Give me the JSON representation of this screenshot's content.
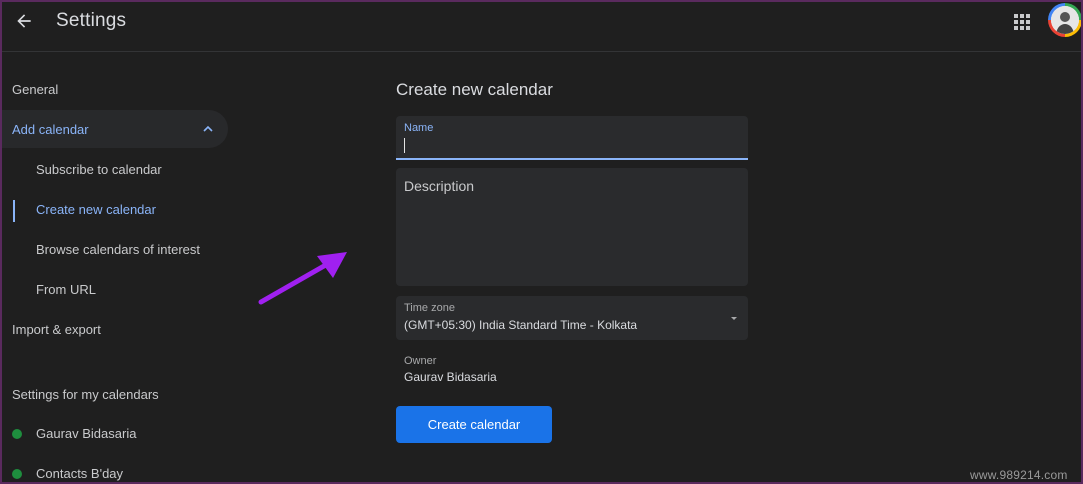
{
  "header": {
    "title": "Settings",
    "back_icon": "arrow-left-icon",
    "apps_icon": "apps-grid-icon"
  },
  "sidebar": {
    "general": "General",
    "add_calendar": "Add calendar",
    "sub_items": [
      "Subscribe to calendar",
      "Create new calendar",
      "Browse calendars of interest",
      "From URL"
    ],
    "import_export": "Import & export",
    "my_calendars_heading": "Settings for my calendars",
    "calendars": [
      {
        "label": "Gaurav Bidasaria",
        "color": "#1e8e3e"
      },
      {
        "label": "Contacts B'day",
        "color": "#1e8e3e"
      }
    ]
  },
  "form": {
    "title": "Create new calendar",
    "name_label": "Name",
    "name_value": "",
    "description_placeholder": "Description",
    "timezone_label": "Time zone",
    "timezone_value": "(GMT+05:30) India Standard Time - Kolkata",
    "owner_label": "Owner",
    "owner_value": "Gaurav Bidasaria",
    "create_button": "Create calendar"
  },
  "colors": {
    "accent": "#8ab4f8",
    "button": "#1a73e8",
    "arrow": "#a020f0"
  },
  "watermark": "www.989214.com"
}
